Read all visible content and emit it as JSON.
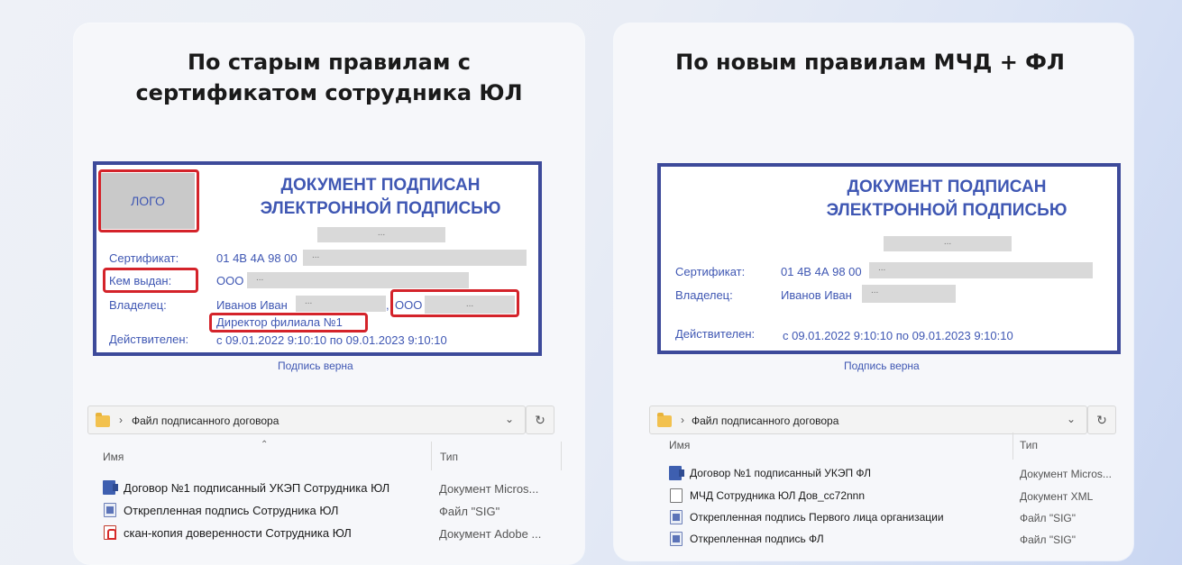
{
  "left": {
    "heading": [
      "По старым правилам с",
      "сертификатом сотрудника ЮЛ"
    ],
    "stamp": {
      "logo": "ЛОГО",
      "title": [
        "ДОКУМЕНТ ПОДПИСАН",
        "ЭЛЕКТРОННОЙ ПОДПИСЬЮ"
      ],
      "placeholder": "...",
      "cert_label": "Сертификат:",
      "cert_value": "01 4В 4А 98 00",
      "issuer_label": "Кем выдан:",
      "issuer_value": "ООО",
      "owner_label": "Владелец:",
      "owner_value": "Иванов Иван",
      "owner_org": "ООО",
      "owner_position": "Директор филиала №1",
      "valid_label": "Действителен:",
      "valid_value": "с 09.01.2022 9:10:10 по 09.01.2023 9:10:10"
    },
    "signature_ok": "Подпись верна",
    "explorer": {
      "path": "Файл подписанного договора",
      "col_name": "Имя",
      "col_type": "Тип",
      "files": [
        {
          "name": "Договор №1 подписанный УКЭП Сотрудника ЮЛ",
          "type": "Документ Micros...",
          "icon": "word-icon"
        },
        {
          "name": "Открепленная подпись Сотрудника ЮЛ",
          "type": "Файл \"SIG\"",
          "icon": "sig-icon"
        },
        {
          "name": "скан-копия доверенности Сотрудника ЮЛ",
          "type": "Документ Adobe ...",
          "icon": "pdf-icon"
        }
      ]
    }
  },
  "right": {
    "heading": [
      "По новым правилам МЧД + ФЛ"
    ],
    "stamp": {
      "title": [
        "ДОКУМЕНТ ПОДПИСАН",
        "ЭЛЕКТРОННОЙ ПОДПИСЬЮ"
      ],
      "placeholder": "...",
      "cert_label": "Сертификат:",
      "cert_value": "01 4В 4А 98 00",
      "owner_label": "Владелец:",
      "owner_value": "Иванов Иван",
      "valid_label": "Действителен:",
      "valid_value": "с 09.01.2022 9:10:10 по 09.01.2023 9:10:10"
    },
    "signature_ok": "Подпись верна",
    "explorer": {
      "path": "Файл подписанного договора",
      "col_name": "Имя",
      "col_type": "Тип",
      "files": [
        {
          "name": "Договор №1 подписанный УКЭП ФЛ",
          "type": "Документ Micros...",
          "icon": "word-icon"
        },
        {
          "name": "МЧД Сотрудника ЮЛ Дов_сс72nnn",
          "type": "Документ XML",
          "icon": "xml-icon"
        },
        {
          "name": "Открепленная подпись Первого лица организации",
          "type": "Файл \"SIG\"",
          "icon": "sig-icon"
        },
        {
          "name": "Открепленная подпись ФЛ",
          "type": "Файл \"SIG\"",
          "icon": "sig-icon"
        }
      ]
    }
  },
  "colors": {
    "stamp_border": "#3d4a9a",
    "stamp_text": "#3f57b3",
    "highlight_red": "#d4232a"
  }
}
